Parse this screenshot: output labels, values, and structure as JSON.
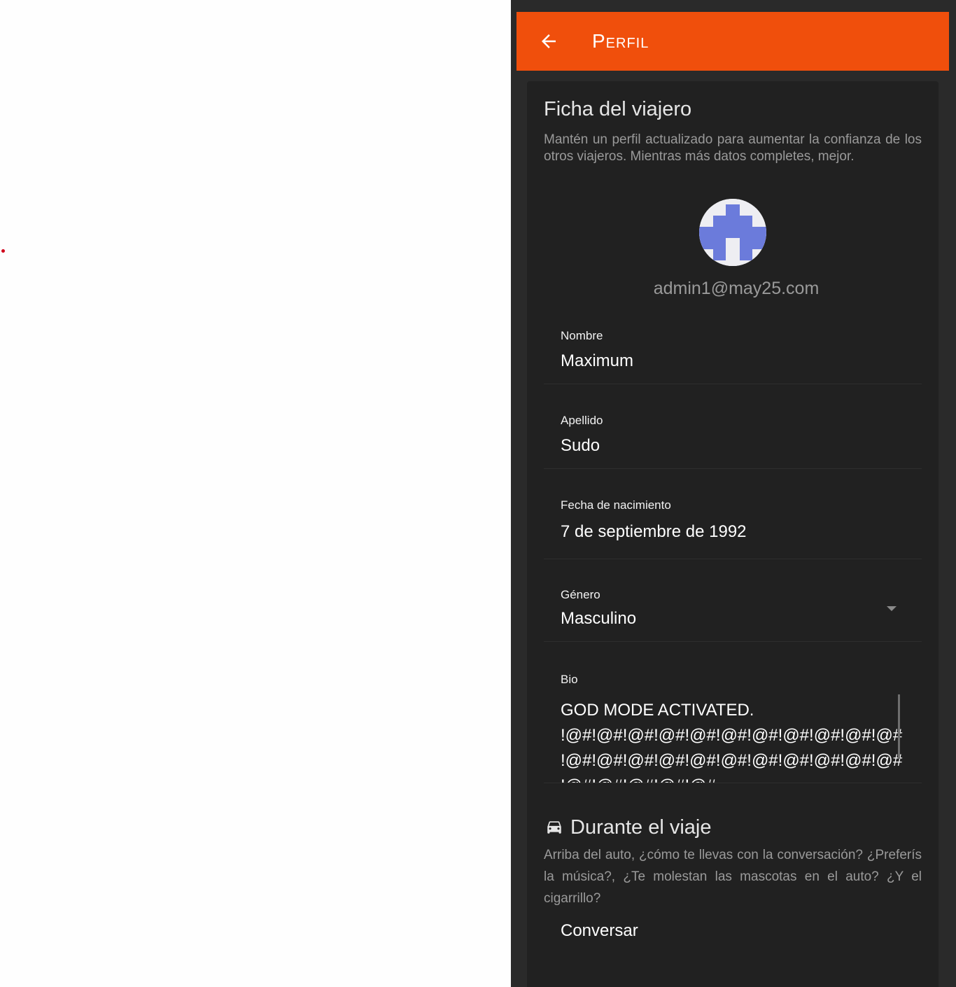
{
  "appbar": {
    "title": "Perfil",
    "back_icon": "arrow-left-icon",
    "color": "#f04f0c"
  },
  "profile": {
    "section_title": "Ficha del viajero",
    "section_desc": "Mantén un perfil actualizado para aumentar la confianza de los otros viajeros. Mientras más datos completes, mejor.",
    "email": "admin1@may25.com",
    "avatar_icon": "identicon-avatar"
  },
  "fields": {
    "nombre": {
      "label": "Nombre",
      "value": "Maximum"
    },
    "apellido": {
      "label": "Apellido",
      "value": "Sudo"
    },
    "fecha": {
      "label": "Fecha de nacimiento",
      "value": "7 de septiembre de 1992"
    },
    "genero": {
      "label": "Género",
      "value": "Masculino",
      "icon": "chevron-down-icon"
    },
    "bio": {
      "label": "Bio",
      "value": "GOD MODE ACTIVATED.\n!@#!@#!@#!@#!@#!@#!@#!@#!@#!@#!@#\n!@#!@#!@#!@#!@#!@#!@#!@#!@#!@#!@#\n!@#!@#!@#!@#!@#"
    }
  },
  "trip": {
    "icon": "car-icon",
    "section_title": "Durante el viaje",
    "section_desc": "Arriba del auto, ¿cómo te llevas con la conversación? ¿Preferís la música?, ¿Te molestan las mascotas en el auto? ¿Y el cigarrillo?",
    "items": [
      {
        "label": "Conversar"
      }
    ]
  }
}
